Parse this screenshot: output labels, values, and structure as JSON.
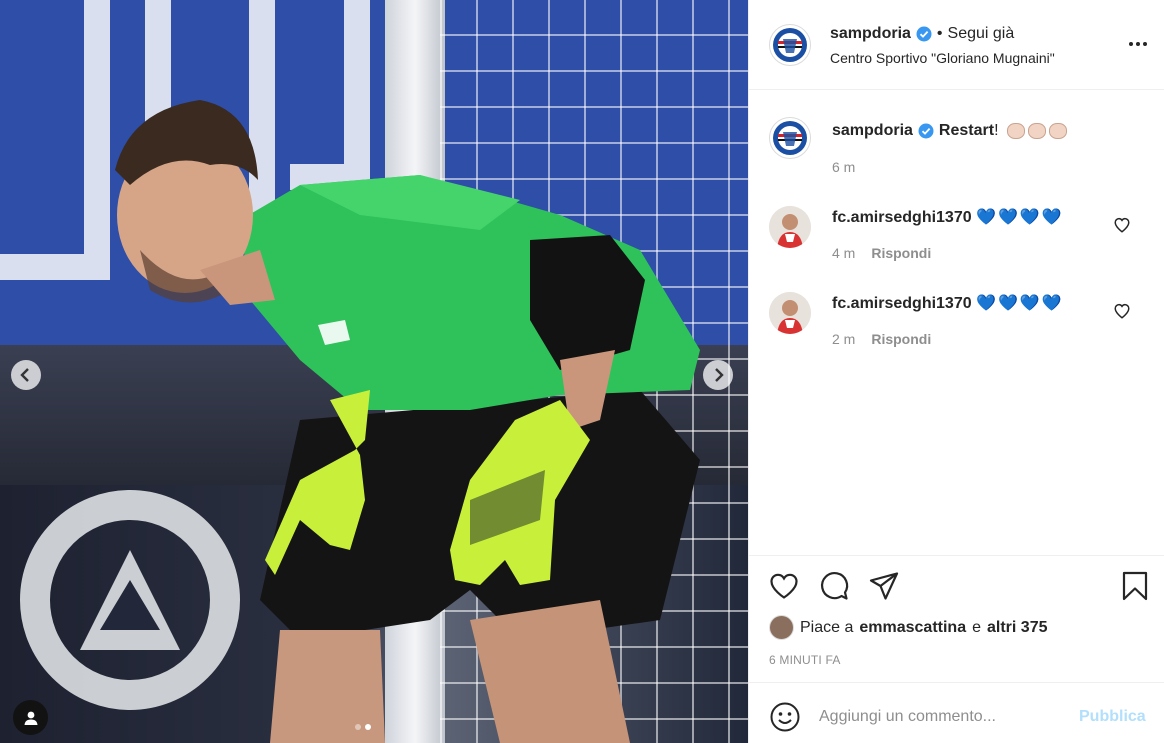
{
  "header": {
    "username": "sampdoria",
    "separator": "•",
    "follow_label": "Segui già",
    "location": "Centro Sportivo \"Gloriano Mugnaini\""
  },
  "caption": {
    "username": "sampdoria",
    "text": "Restart",
    "punctuation": "!",
    "time": "6 m"
  },
  "comments": [
    {
      "username": "fc.amirsedghi1370",
      "text": "💙💙💙💙",
      "time": "4 m",
      "reply_label": "Rispondi"
    },
    {
      "username": "fc.amirsedghi1370",
      "text": "💙💙💙💙",
      "time": "2 m",
      "reply_label": "Rispondi"
    }
  ],
  "likes": {
    "prefix": "Piace a",
    "user": "emmascattina",
    "conjunction": "e",
    "others": "altri 375"
  },
  "timestamp": "6 MINUTI FA",
  "comment_box": {
    "placeholder": "Aggiungi un commento...",
    "publish_label": "Pubblica"
  },
  "carousel": {
    "current": 2,
    "total": 2
  },
  "colors": {
    "verified": "#3897f0",
    "publish_disabled": "#b2dffc",
    "hearts": "#1e6ed8"
  },
  "icons": [
    "heart-icon",
    "comment-icon",
    "share-icon",
    "bookmark-icon",
    "smile-icon",
    "more-icon",
    "user-tag-icon",
    "chevron-left-icon",
    "chevron-right-icon"
  ]
}
